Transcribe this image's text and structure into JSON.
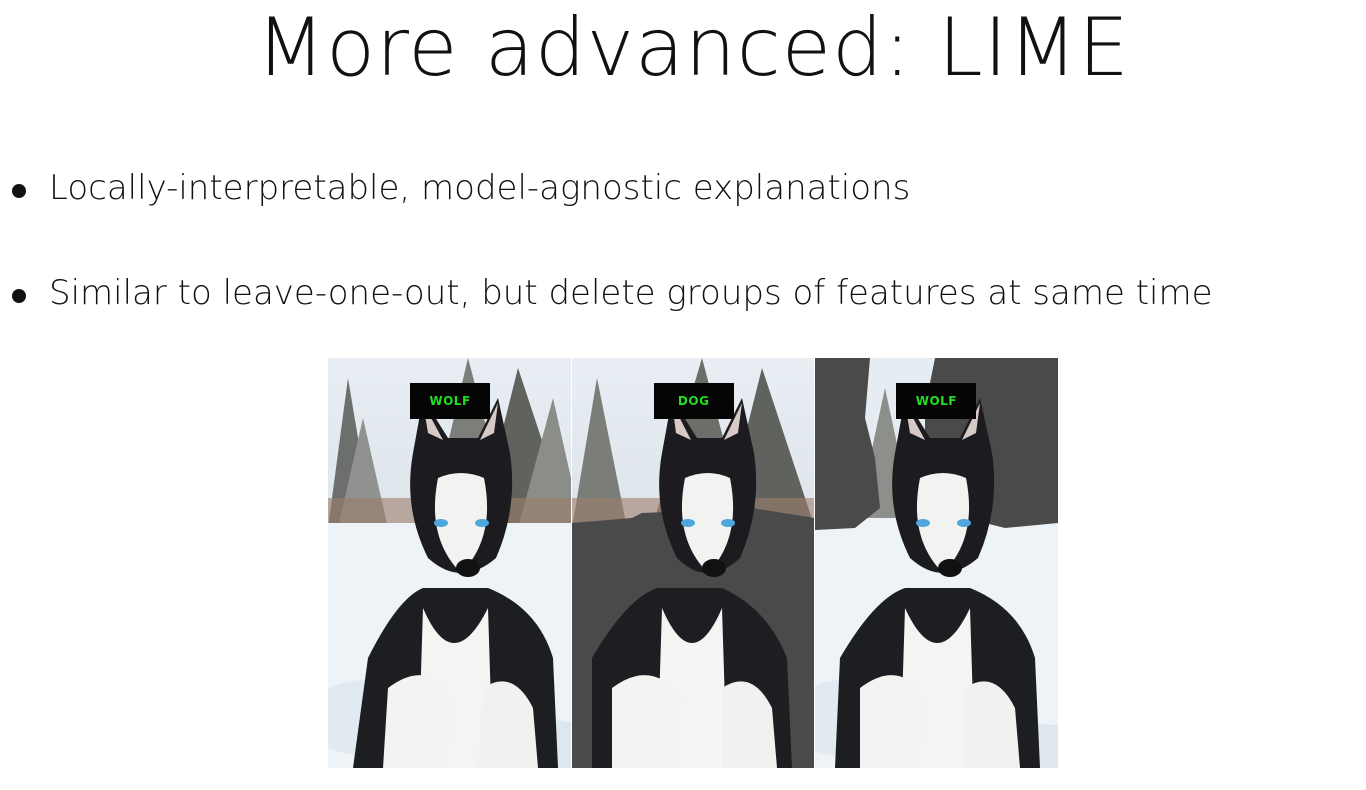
{
  "slide": {
    "title": "More advanced: LIME",
    "bullets": [
      "Locally-interpretable, model-agnostic explanations",
      "Similar to leave-one-out, but delete groups of features at same time"
    ]
  },
  "figure": {
    "panels": [
      {
        "label": "WOLF",
        "masked": "none"
      },
      {
        "label": "DOG",
        "masked": "background"
      },
      {
        "label": "WOLF",
        "masked": "snowy-background-only"
      }
    ],
    "colors": {
      "mask": "#4a4a4a",
      "label_bg": "#050505",
      "label_text": "#22dd22"
    }
  }
}
